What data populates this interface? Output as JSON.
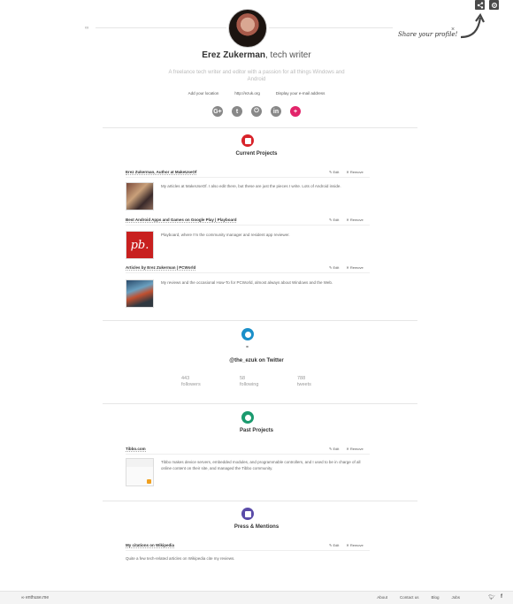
{
  "topbar": {
    "share_hint": "Share your profile!",
    "share_close": "×",
    "logo_glyph": "∞"
  },
  "profile": {
    "name": "Erez Zukerman",
    "role": ", tech writer",
    "bio": "A freelance tech writer and editor with a passion for all things Windows and Android",
    "location": "Add your location",
    "website": "http://ezuk.org",
    "email": "Display your e-mail address"
  },
  "social": [
    "G+",
    "t",
    "⏻",
    "in",
    "+"
  ],
  "current": {
    "title": "Current Projects",
    "items": [
      {
        "title": "Erez Zukerman, Author at MakeUseOf",
        "desc": "My articles at MakeUseOf. I also edit there, but these are just the pieces I write. Lots of Android inside.",
        "edit": "Edit",
        "remove": "Remove"
      },
      {
        "title": "Best Android Apps and Games on Google Play | Playboard",
        "desc": "Playboard, where I'm the community manager and resident app reviewer.",
        "edit": "Edit",
        "remove": "Remove",
        "thumb": "pb."
      },
      {
        "title": "Articles by Erez Zukerman | PCWorld",
        "desc": "My reviews and the occasional How-To for PCWorld, almost always about Windows and the Web.",
        "edit": "Edit",
        "remove": "Remove"
      }
    ]
  },
  "twitter": {
    "handle": "@the_ezuk on Twitter",
    "stats": [
      {
        "value": "443",
        "label": "followers"
      },
      {
        "value": "58",
        "label": "following"
      },
      {
        "value": "788",
        "label": "tweets"
      }
    ]
  },
  "past": {
    "title": "Past Projects",
    "items": [
      {
        "title": "Tibbo.com",
        "desc": "Tibbo makes device servers, embedded modules, and programmable controllers, and I used to be in charge of all online content on their site, and managed the Tibbo community.",
        "edit": "Edit",
        "remove": "Remove"
      }
    ]
  },
  "press": {
    "title": "Press & Mentions",
    "items": [
      {
        "title": "My citations on Wikipedia",
        "desc": "Quite a few tech-related articles on Wikipedia cite my reviews.",
        "edit": "Edit",
        "remove": "Remove"
      }
    ]
  },
  "footer": {
    "brand": "enthuse.me",
    "links": [
      "About",
      "Contact us",
      "Blog",
      "Jobs"
    ],
    "icons": [
      "twitter-icon",
      "facebook-icon"
    ]
  },
  "colors": {
    "accent_red": "#d8232a",
    "twitter_blue": "#1a8fc9",
    "past_green": "#1a9a6e",
    "press_purple": "#5a4ba8",
    "pink": "#e2246a"
  }
}
